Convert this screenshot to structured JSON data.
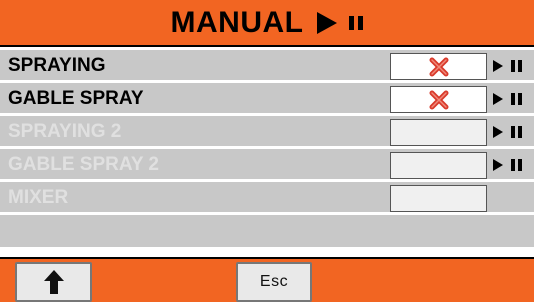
{
  "header": {
    "title": "MANUAL",
    "play_icon": "play-icon",
    "pause_icon": "pause-icon"
  },
  "rows": [
    {
      "label": "SPRAYING",
      "enabled": true,
      "status": "off",
      "status_icon": "red-x-icon",
      "controls": [
        "play-icon",
        "pause-icon"
      ]
    },
    {
      "label": "GABLE SPRAY",
      "enabled": true,
      "status": "off",
      "status_icon": "red-x-icon",
      "controls": [
        "play-icon",
        "pause-icon"
      ]
    },
    {
      "label": "SPRAYING 2",
      "enabled": false,
      "controls": [
        "play-icon",
        "pause-icon"
      ]
    },
    {
      "label": "GABLE SPRAY 2",
      "enabled": false,
      "controls": [
        "play-icon",
        "pause-icon"
      ]
    },
    {
      "label": "MIXER",
      "enabled": false
    }
  ],
  "footer": {
    "up_icon": "up-arrow-icon",
    "esc_label": "Esc"
  },
  "colors": {
    "accent": "#f26522",
    "row_bg": "#c8c8c8",
    "x_red": "#d93a2b"
  }
}
